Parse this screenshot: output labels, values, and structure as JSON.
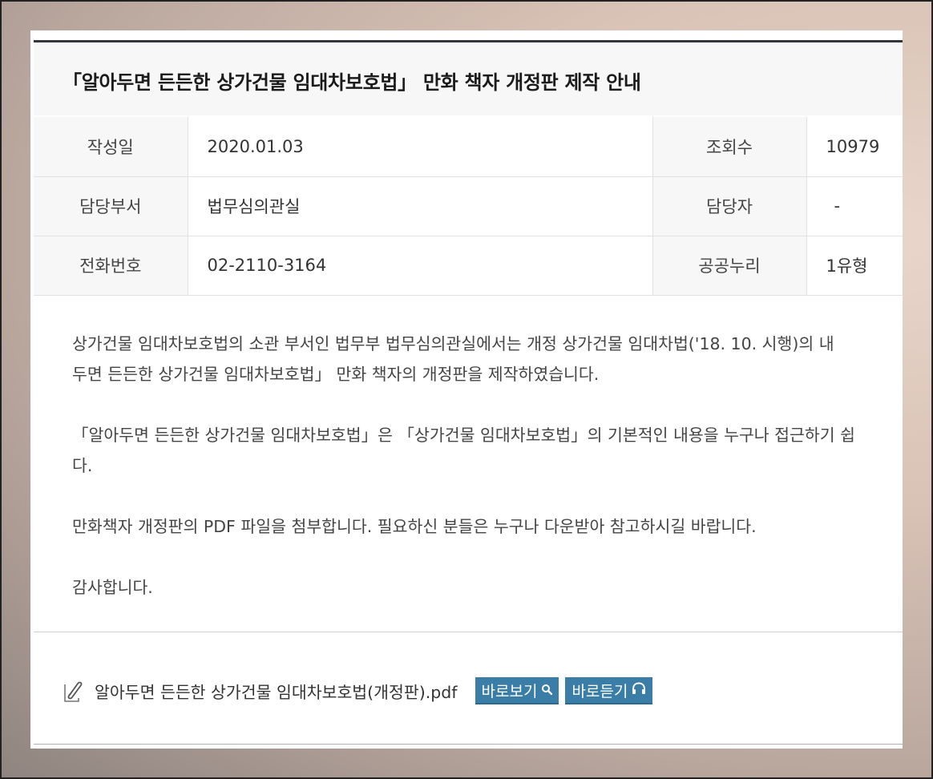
{
  "post": {
    "title": "「알아두면 든든한 상가건물 임대차보호법」 만화 책자 개정판 제작 안내"
  },
  "meta": {
    "date_label": "작성일",
    "date_value": "2020.01.03",
    "views_label": "조회수",
    "views_value": "10979",
    "dept_label": "담당부서",
    "dept_value": "법무심의관실",
    "manager_label": "담당자",
    "manager_value": "-",
    "phone_label": "전화번호",
    "phone_value": "02-2110-3164",
    "license_label": "공공누리",
    "license_value": "1유형"
  },
  "content": {
    "p1_line1": "상가건물 임대차보호법의 소관 부서인 법무부 법무심의관실에서는 개정 상가건물 임대차법('18. 10. 시행)의 내",
    "p1_line2": "두면 든든한 상가건물 임대차보호법」 만화 책자의 개정판을 제작하였습니다.",
    "p2_line1": "「알아두면 든든한 상가건물 임대차보호법」은 「상가건물 임대차보호법」의 기본적인 내용을 누구나 접근하기 쉽",
    "p2_line2": "다.",
    "p3": "만화책자 개정판의 PDF 파일을 첨부합니다. 필요하신 분들은 누구나 다운받아 참고하시길 바랍니다.",
    "p4": "감사합니다."
  },
  "attachment": {
    "icon": "paperclip-icon",
    "filename": "알아두면 든든한 상가건물 임대차보호법(개정판).pdf",
    "view_label": "바로보기",
    "view_icon": "search-icon",
    "listen_label": "바로듣기",
    "listen_icon": "headphones-icon"
  },
  "colors": {
    "button": "#3a7ea7",
    "title_border": "#33373d",
    "label_bg": "#f7f7f7"
  }
}
